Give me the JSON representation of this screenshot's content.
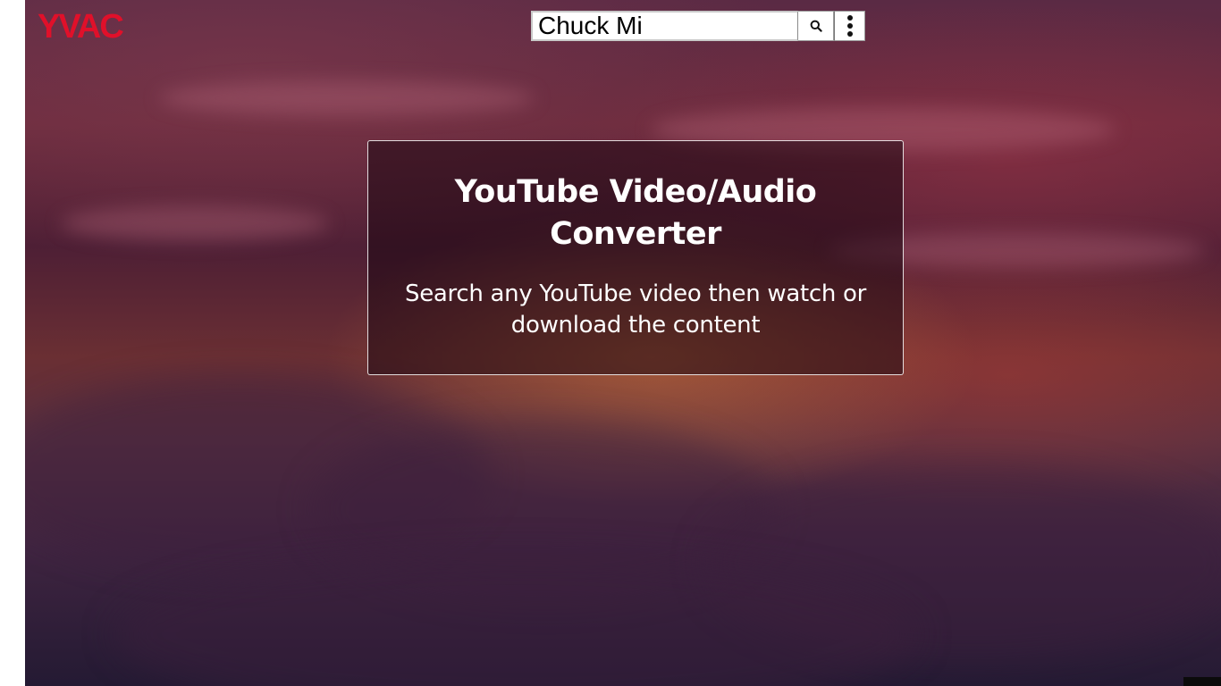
{
  "header": {
    "logo_text": "YVAC",
    "search": {
      "value": "Chuck Mi",
      "search_icon": "search-icon",
      "menu_icon": "vertical-dots-icon"
    }
  },
  "main": {
    "card": {
      "title": "YouTube Video/Audio Converter",
      "subtitle": "Search any YouTube video then watch or download the content"
    }
  },
  "colors": {
    "logo": "#e0102a",
    "card_border": "#ffffff",
    "text": "#ffffff"
  }
}
